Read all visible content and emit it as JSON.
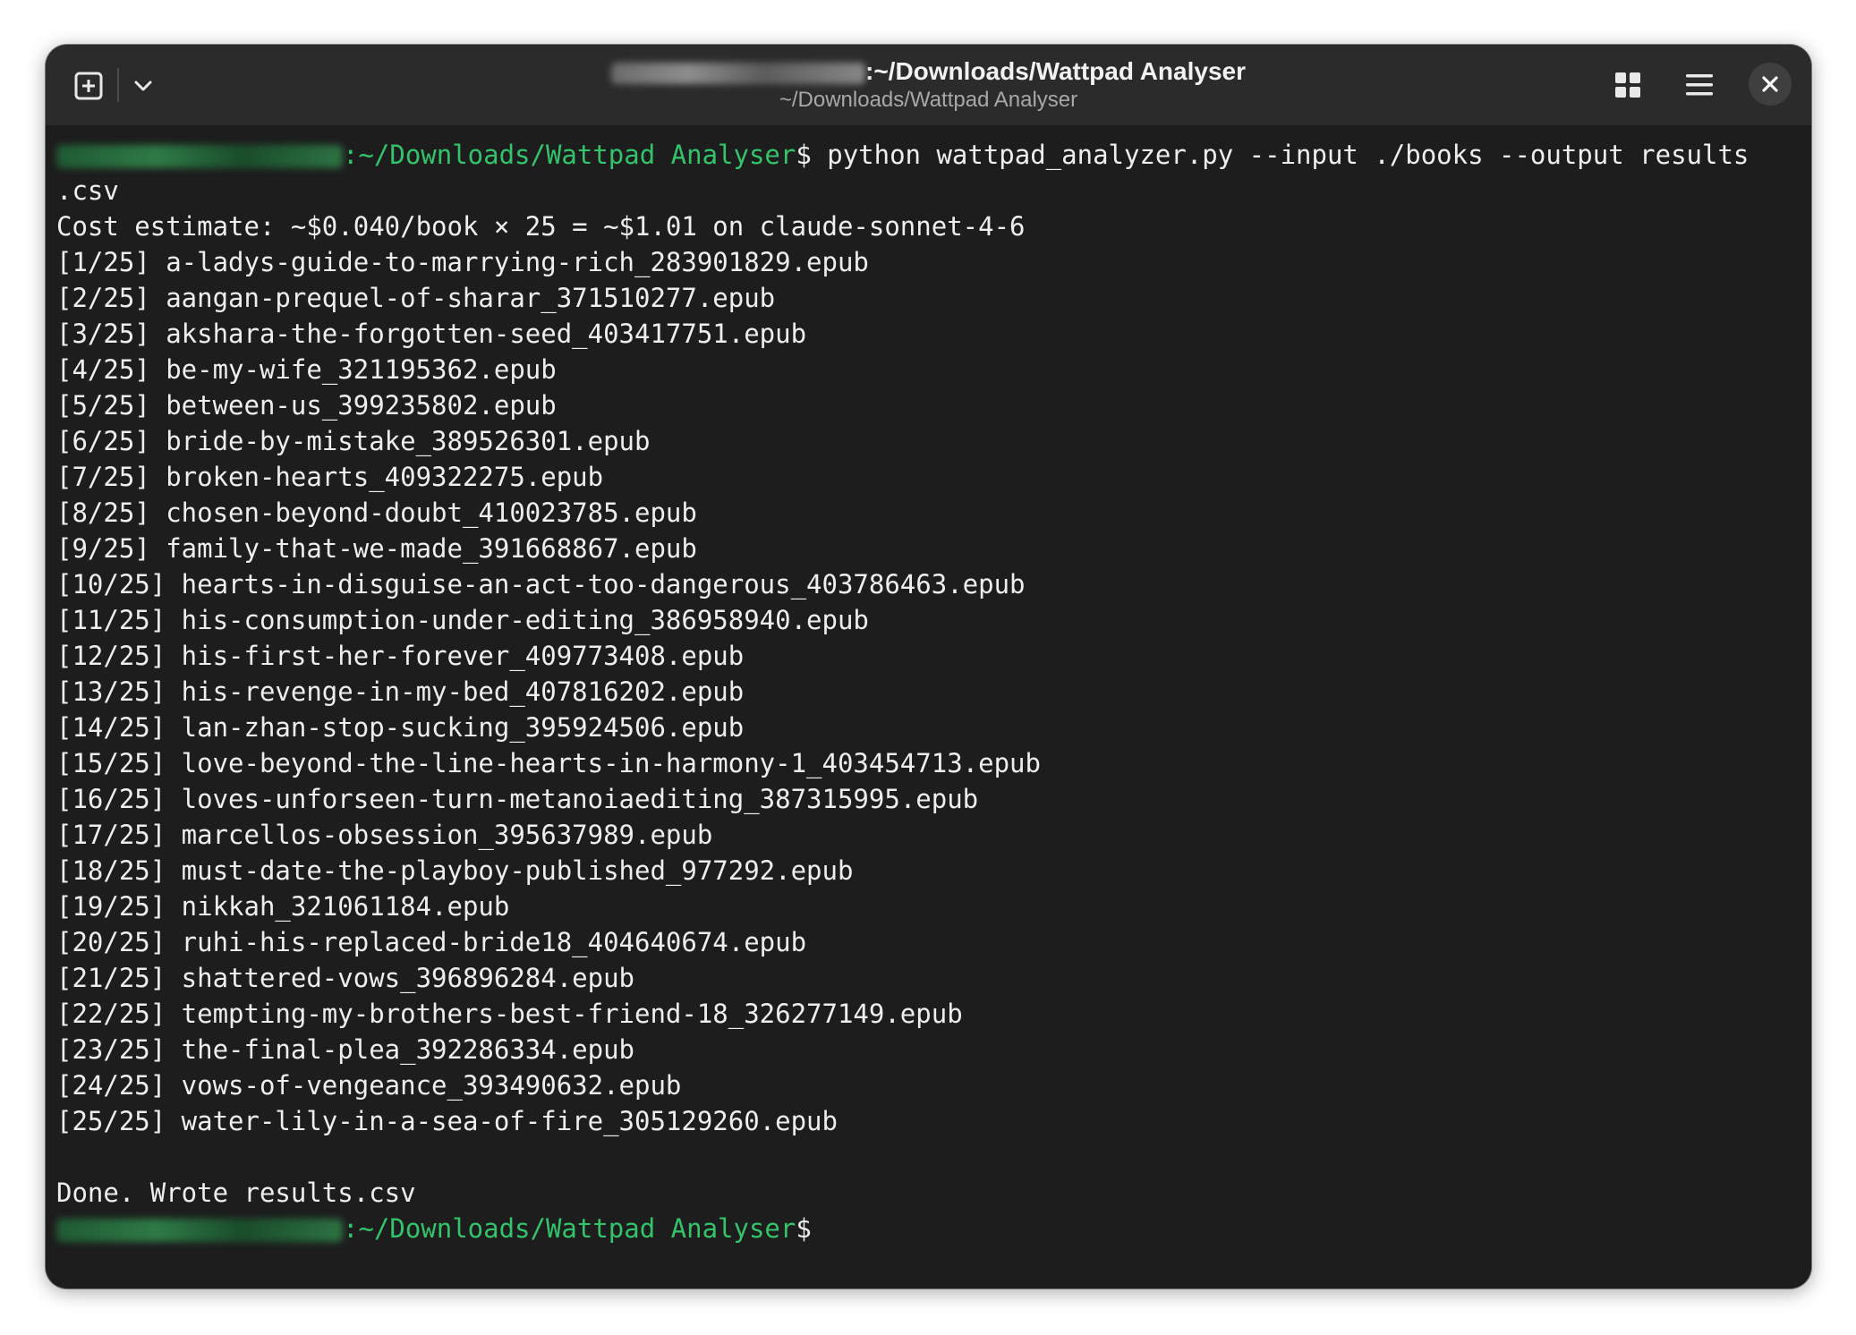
{
  "window": {
    "title_path": ":~/Downloads/Wattpad Analyser",
    "subtitle": "~/Downloads/Wattpad Analyser"
  },
  "titlebar_icons": {
    "new_tab": "new-tab-icon",
    "dropdown": "chevron-down-icon",
    "grid": "grid-view-icon",
    "menu": "hamburger-menu-icon",
    "close": "close-icon"
  },
  "prompt": {
    "path": ":~/Downloads/Wattpad Analyser",
    "symbol": "$"
  },
  "command": " python wattpad_analyzer.py --input ./books --output results",
  "command_wrap": ".csv",
  "cost_line": "Cost estimate: ~$0.040/book × 25 = ~$1.01 on claude-sonnet-4-6",
  "progress": [
    "[1/25] a-ladys-guide-to-marrying-rich_283901829.epub",
    "[2/25] aangan-prequel-of-sharar_371510277.epub",
    "[3/25] akshara-the-forgotten-seed_403417751.epub",
    "[4/25] be-my-wife_321195362.epub",
    "[5/25] between-us_399235802.epub",
    "[6/25] bride-by-mistake_389526301.epub",
    "[7/25] broken-hearts_409322275.epub",
    "[8/25] chosen-beyond-doubt_410023785.epub",
    "[9/25] family-that-we-made_391668867.epub",
    "[10/25] hearts-in-disguise-an-act-too-dangerous_403786463.epub",
    "[11/25] his-consumption-under-editing_386958940.epub",
    "[12/25] his-first-her-forever_409773408.epub",
    "[13/25] his-revenge-in-my-bed_407816202.epub",
    "[14/25] lan-zhan-stop-sucking_395924506.epub",
    "[15/25] love-beyond-the-line-hearts-in-harmony-1_403454713.epub",
    "[16/25] loves-unforseen-turn-metanoiaediting_387315995.epub",
    "[17/25] marcellos-obsession_395637989.epub",
    "[18/25] must-date-the-playboy-published_977292.epub",
    "[19/25] nikkah_321061184.epub",
    "[20/25] ruhi-his-replaced-bride18_404640674.epub",
    "[21/25] shattered-vows_396896284.epub",
    "[22/25] tempting-my-brothers-best-friend-18_326277149.epub",
    "[23/25] the-final-plea_392286334.epub",
    "[24/25] vows-of-vengeance_393490632.epub",
    "[25/25] water-lily-in-a-sea-of-fire_305129260.epub"
  ],
  "done_line": "Done. Wrote results.csv"
}
